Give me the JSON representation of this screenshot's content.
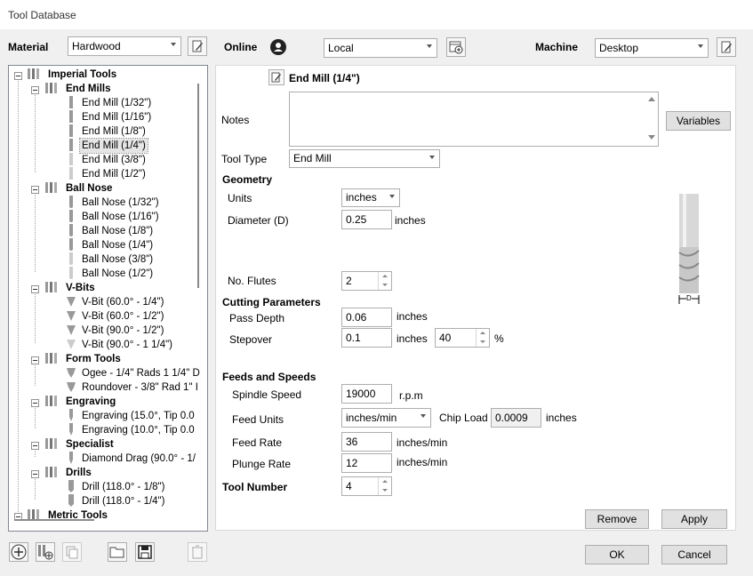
{
  "window": {
    "title": "Tool Database"
  },
  "header": {
    "material_label": "Material",
    "material_value": "Hardwood",
    "online_label": "Online",
    "location_value": "Local",
    "machine_label": "Machine",
    "machine_value": "Desktop"
  },
  "tree": {
    "groups": [
      {
        "label": "Imperial Tools"
      },
      {
        "label": "End Mills",
        "items": [
          "End Mill (1/32\")",
          "End Mill (1/16\")",
          "End Mill (1/8\")",
          "End Mill (1/4\")",
          "End Mill (3/8\")",
          "End Mill (1/2\")"
        ]
      },
      {
        "label": "Ball Nose",
        "items": [
          "Ball Nose (1/32\")",
          "Ball Nose (1/16\")",
          "Ball Nose (1/8\")",
          "Ball Nose (1/4\")",
          "Ball Nose (3/8\")",
          "Ball Nose (1/2\")"
        ]
      },
      {
        "label": "V-Bits",
        "items": [
          "V-Bit (60.0° - 1/4\")",
          "V-Bit (60.0° - 1/2\")",
          "V-Bit (90.0° - 1/2\")",
          "V-Bit (90.0° - 1 1/4\")"
        ]
      },
      {
        "label": "Form Tools",
        "items": [
          "Ogee - 1/4\" Rads 1 1/4\" D",
          "Roundover - 3/8\" Rad 1\" I"
        ]
      },
      {
        "label": "Engraving",
        "items": [
          "Engraving (15.0°, Tip 0.0",
          "Engraving (10.0°, Tip 0.0"
        ]
      },
      {
        "label": "Specialist",
        "items": [
          "Diamond Drag (90.0° - 1/"
        ]
      },
      {
        "label": "Drills",
        "items": [
          "Drill (118.0° - 1/8\")",
          "Drill (118.0° - 1/4\")"
        ]
      },
      {
        "label": "Metric Tools"
      }
    ],
    "selected": "End Mill (1/4\")"
  },
  "detail": {
    "tool_name": "End Mill (1/4\")",
    "notes_label": "Notes",
    "notes_value": "",
    "variables_button": "Variables",
    "tool_type_label": "Tool Type",
    "tool_type_value": "End Mill",
    "geometry_heading": "Geometry",
    "units_label": "Units",
    "units_value": "inches",
    "diameter_label": "Diameter (D)",
    "diameter_value": "0.25",
    "diameter_unit": "inches",
    "flutes_label": "No. Flutes",
    "flutes_value": "2",
    "diagram_label": "D",
    "cutting_heading": "Cutting Parameters",
    "pass_depth_label": "Pass Depth",
    "pass_depth_value": "0.06",
    "pass_depth_unit": "inches",
    "stepover_label": "Stepover",
    "stepover_value": "0.1",
    "stepover_unit": "inches",
    "stepover_percent": "40",
    "percent_sign": "%",
    "feeds_heading": "Feeds and Speeds",
    "spindle_label": "Spindle Speed",
    "spindle_value": "19000",
    "spindle_unit": "r.p.m",
    "feed_units_label": "Feed Units",
    "feed_units_value": "inches/min",
    "chip_load_label": "Chip Load",
    "chip_load_value": "0.0009",
    "chip_load_unit": "inches",
    "feed_rate_label": "Feed Rate",
    "feed_rate_value": "36",
    "feed_rate_unit": "inches/min",
    "plunge_rate_label": "Plunge Rate",
    "plunge_rate_value": "12",
    "plunge_rate_unit": "inches/min",
    "tool_number_label": "Tool Number",
    "tool_number_value": "4",
    "remove_button": "Remove",
    "apply_button": "Apply"
  },
  "footer": {
    "ok_button": "OK",
    "cancel_button": "Cancel",
    "icons": [
      "add-icon",
      "add-group-icon",
      "copy-icon",
      "open-folder-icon",
      "save-icon",
      "delete-icon"
    ]
  }
}
